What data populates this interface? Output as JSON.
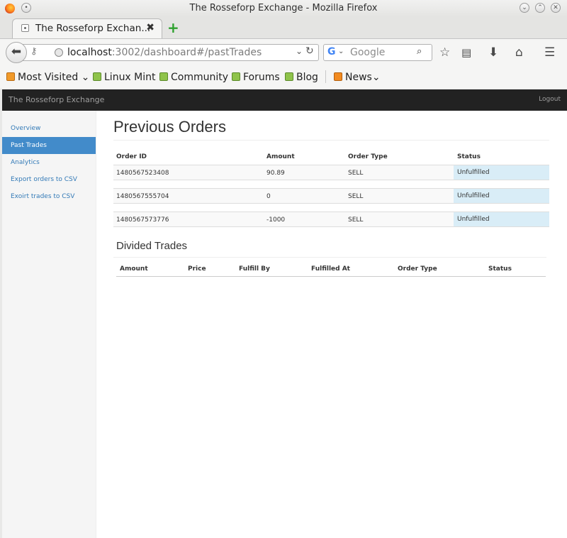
{
  "window": {
    "title": "The Rosseforp Exchange - Mozilla Firefox"
  },
  "tab": {
    "label": "The Rosseforp Exchan...",
    "close": "✖",
    "new_tab": "+"
  },
  "navbar": {
    "url_host": "localhost",
    "url_rest": ":3002/dashboard#/pastTrades",
    "search_engine": "G",
    "search_placeholder": "Google",
    "icons": [
      "back-icon",
      "key-icon",
      "globe-icon",
      "reload-icon",
      "binoculars-icon",
      "star-icon",
      "reading-list-icon",
      "download-icon",
      "home-icon",
      "menu-icon"
    ]
  },
  "bookmarks": [
    {
      "label": "Most Visited",
      "icon": "most-visited-icon",
      "chevron": "⌄"
    },
    {
      "label": "Linux Mint",
      "icon": "mint-icon"
    },
    {
      "label": "Community",
      "icon": "mint-icon"
    },
    {
      "label": "Forums",
      "icon": "mint-icon"
    },
    {
      "label": "Blog",
      "icon": "mint-icon"
    },
    {
      "label": "News",
      "icon": "rss-icon",
      "chevron": "⌄"
    }
  ],
  "app": {
    "brand": "The Rosseforp Exchange",
    "logout": "Logout"
  },
  "sidebar": {
    "items": [
      {
        "label": "Overview",
        "active": false
      },
      {
        "label": "Past Trades",
        "active": true
      },
      {
        "label": "Analytics",
        "active": false
      },
      {
        "label": "Export orders to CSV",
        "active": false
      },
      {
        "label": "Exoirt trades to CSV",
        "active": false
      }
    ]
  },
  "orders": {
    "heading": "Previous Orders",
    "columns": [
      "Order ID",
      "Amount",
      "Order Type",
      "Status"
    ],
    "rows": [
      {
        "id": "1480567523408",
        "amount": "90.89",
        "type": "SELL",
        "status": "Unfulfilled"
      },
      {
        "id": "1480567555704",
        "amount": "0",
        "type": "SELL",
        "status": "Unfulfilled"
      },
      {
        "id": "1480567573776",
        "amount": "-1000",
        "type": "SELL",
        "status": "Unfulfilled"
      }
    ]
  },
  "trades": {
    "heading": "Divided Trades",
    "columns": [
      "Amount",
      "Price",
      "Fulfill By",
      "Fulfilled At",
      "Order Type",
      "Status"
    ]
  },
  "colors": {
    "navbar": "#222222",
    "active": "#428bca",
    "status_bg": "#d9edf7",
    "link": "#337ab7"
  }
}
